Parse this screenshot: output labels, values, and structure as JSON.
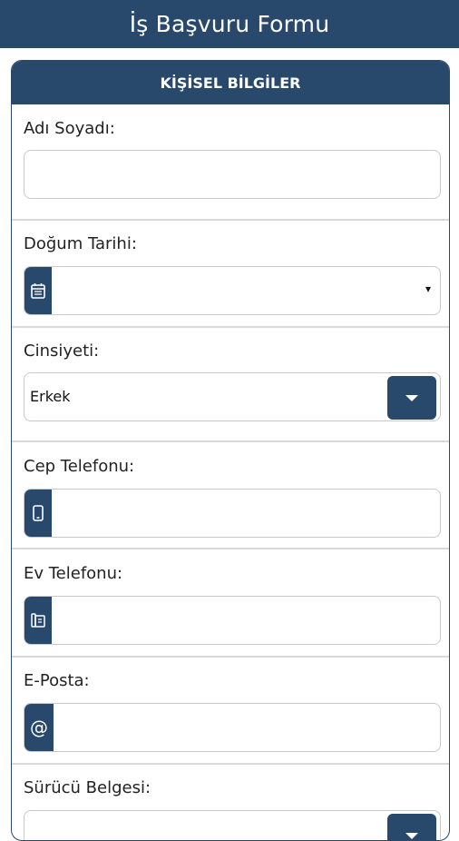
{
  "app": {
    "title": "İş Başvuru Formu"
  },
  "section": {
    "title": "KİŞİSEL BİLGİLER"
  },
  "fields": {
    "name": {
      "label": "Adı Soyadı:",
      "value": ""
    },
    "birth_date": {
      "label": "Doğum Tarihi:",
      "value": "",
      "caret": "▾"
    },
    "gender": {
      "label": "Cinsiyeti:",
      "value": "Erkek"
    },
    "mobile": {
      "label": "Cep Telefonu:",
      "value": ""
    },
    "home_phone": {
      "label": "Ev Telefonu:",
      "value": ""
    },
    "email": {
      "label": "E-Posta:",
      "value": "",
      "addon": "@"
    },
    "license": {
      "label": "Sürücü Belgesi:"
    }
  },
  "colors": {
    "primary": "#28496b",
    "border": "#c9c9c9",
    "divider": "#d9d9d9"
  },
  "icons": {
    "birth_date": "calendar-icon",
    "gender": "caret-down-icon",
    "mobile": "mobile-phone-icon",
    "home_phone": "desk-phone-icon",
    "email": "at-sign-icon"
  }
}
